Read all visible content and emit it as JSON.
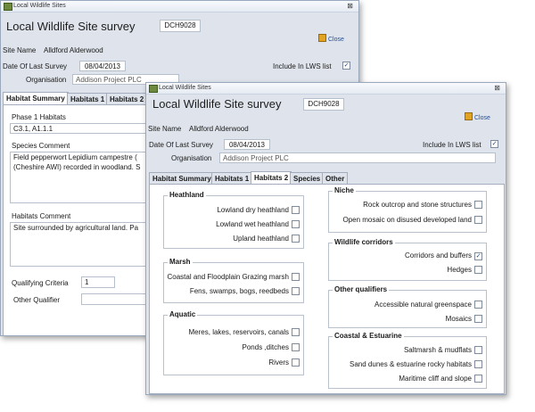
{
  "back_window": {
    "titlebar": {
      "text": "Local Wildlife Sites",
      "close": "⊠"
    },
    "title": "Local Wildlife Site survey",
    "code": "DCH9028",
    "close_label": "Close",
    "site_name_label": "Site Name",
    "site_name": "Alldford Alderwood",
    "date_label": "Date Of Last Survey",
    "date": "08/04/2013",
    "include_label": "Include In LWS list",
    "include_checked": "✓",
    "org_label": "Organisation",
    "org": "Addison Project PLC",
    "tabs": [
      "Habitat Summary",
      "Habitats 1",
      "Habitats 2"
    ],
    "phase1_label": "Phase 1 Habitats",
    "phase1": "C3.1, A1.1.1",
    "species_label": "Species Comment",
    "species_line1": "Field pepperwort Lepidium campestre (",
    "species_line2": "(Cheshire AWI) recorded in woodland. S",
    "habitats_comment_label": "Habitats Comment",
    "habitats_comment": "Site surrounded by agricultural land. Pa",
    "qualifying_label": "Qualifying Criteria",
    "qualifying": "1",
    "other_qualifier_label": "Other Qualifier"
  },
  "front_window": {
    "titlebar": {
      "text": "Local Wildlife Sites",
      "close": "⊠"
    },
    "title": "Local Wildlife Site survey",
    "code": "DCH9028",
    "close_label": "Close",
    "site_name_label": "Site Name",
    "site_name": "Alldford Alderwood",
    "date_label": "Date Of Last Survey",
    "date": "08/04/2013",
    "include_label": "Include In LWS list",
    "include_checked": "✓",
    "org_label": "Organisation",
    "org": "Addison Project PLC",
    "tabs": [
      "Habitat Summary",
      "Habitats 1",
      "Habitats 2",
      "Species",
      "Other"
    ],
    "groups": {
      "heathland": {
        "title": "Heathland",
        "items": [
          "Lowland dry heathland",
          "Lowland wet heathland",
          "Upland heathland"
        ]
      },
      "marsh": {
        "title": "Marsh",
        "items": [
          "Coastal and Floodplain Grazing marsh",
          "Fens, swamps, bogs, reedbeds"
        ]
      },
      "aquatic": {
        "title": "Aquatic",
        "items": [
          "Meres, lakes, reservoirs, canals",
          "Ponds ,ditches",
          "Rivers"
        ]
      },
      "niche": {
        "title": "Niche",
        "items": [
          "Rock outcrop and stone structures",
          "Open mosaic on disused developed land"
        ]
      },
      "corridors": {
        "title": "Wildlife corridors",
        "items": [
          "Corridors and buffers",
          "Hedges"
        ],
        "checked": [
          "✓",
          ""
        ]
      },
      "other_q": {
        "title": "Other qualifiers",
        "items": [
          "Accessible natural greenspace",
          "Mosaics"
        ]
      },
      "coastal": {
        "title": "Coastal & Estuarine",
        "items": [
          "Saltmarsh & mudflats",
          "Sand dunes & estuarine rocky habitats",
          "Maritime cliff and slope"
        ]
      }
    }
  }
}
